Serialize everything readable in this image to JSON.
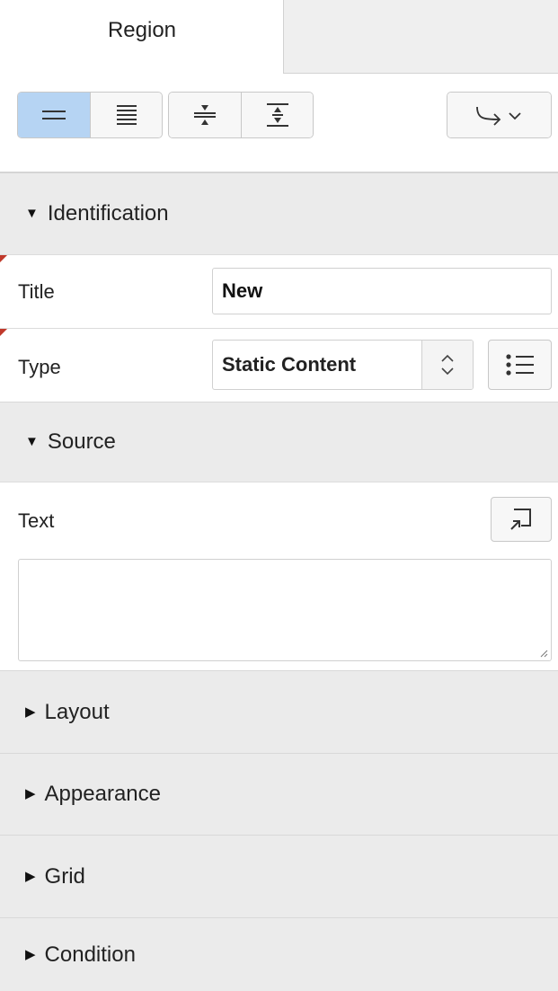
{
  "tabs": {
    "active": "Region",
    "inactive": ""
  },
  "toolbar": {
    "icons": [
      "show-common-icon",
      "show-all-icon",
      "collapse-all-icon",
      "expand-all-icon",
      "go-to-group-icon"
    ]
  },
  "sections": {
    "identification": "Identification",
    "source": "Source",
    "layout": "Layout",
    "appearance": "Appearance",
    "grid": "Grid",
    "condition": "Condition"
  },
  "fields": {
    "title": {
      "label": "Title",
      "value": "New"
    },
    "type": {
      "label": "Type",
      "value": "Static Content"
    },
    "text": {
      "label": "Text",
      "value": ""
    }
  },
  "colors": {
    "active_button": "#b6d4f3",
    "section_bg": "#ebebeb",
    "required_marker": "#c0392b"
  }
}
